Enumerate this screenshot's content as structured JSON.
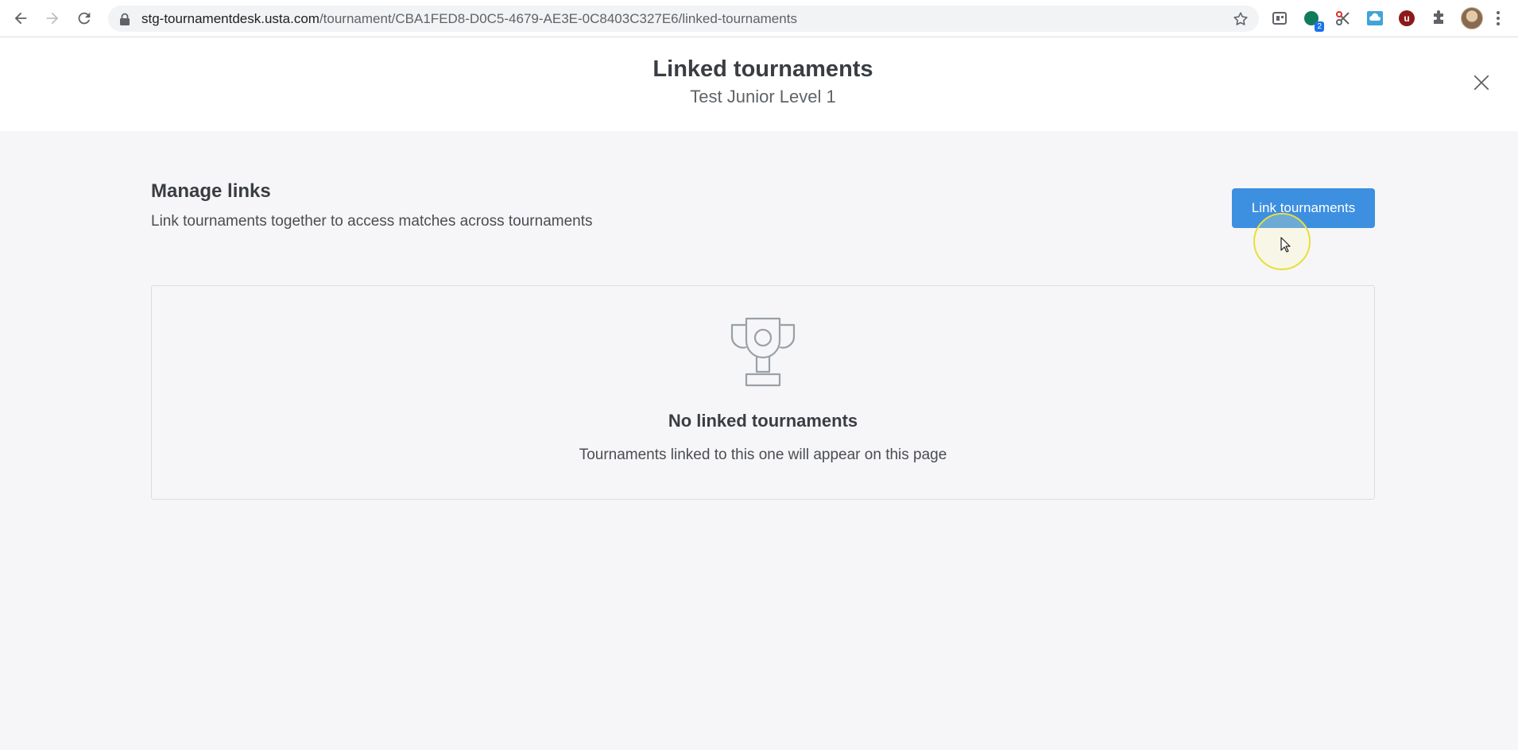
{
  "browser": {
    "url_host": "stg-tournamentdesk.usta.com",
    "url_path": "/tournament/CBA1FED8-D0C5-4679-AE3E-0C8403C327E6/linked-tournaments",
    "extensions": [
      {
        "icon": "puzzle-ext-icon"
      },
      {
        "icon": "green-circle-ext-icon",
        "badge": "2"
      },
      {
        "icon": "scissors-ext-icon"
      },
      {
        "icon": "cloud-ext-icon"
      },
      {
        "icon": "u-ext-icon",
        "label": "u"
      },
      {
        "icon": "extensions-puzzle-icon"
      }
    ]
  },
  "header": {
    "title": "Linked tournaments",
    "subtitle": "Test Junior Level 1"
  },
  "section": {
    "title": "Manage links",
    "description": "Link tournaments together to access matches across tournaments",
    "button_label": "Link tournaments"
  },
  "empty_state": {
    "icon": "trophy-icon",
    "title": "No linked tournaments",
    "description": "Tournaments linked to this one will appear on this page"
  },
  "colors": {
    "primary_button": "#3d8fe0",
    "page_background": "#f6f6f8",
    "header_background": "#ffffff"
  }
}
